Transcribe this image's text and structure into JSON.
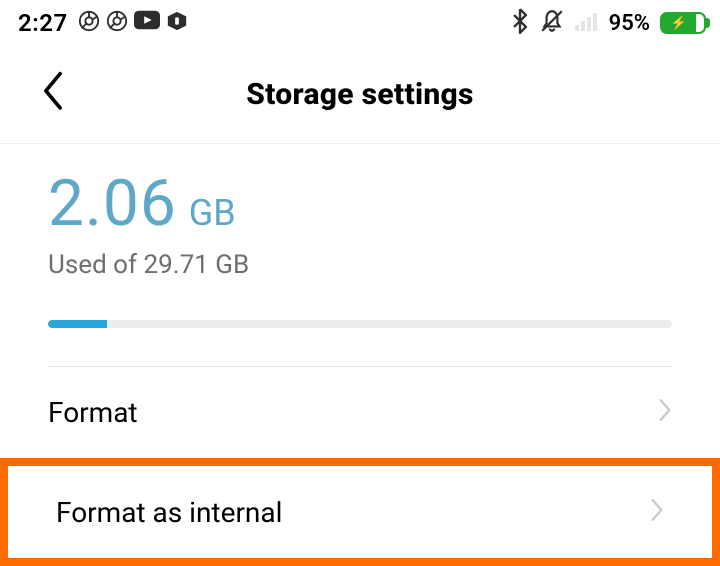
{
  "status": {
    "time": "2:27",
    "battery_percent": "95%"
  },
  "header": {
    "title": "Storage settings"
  },
  "storage": {
    "used_value": "2.06",
    "used_unit": "GB",
    "used_of_line": "Used of 29.71 GB",
    "progress_pct": 7
  },
  "rows": {
    "format": "Format",
    "format_internal": "Format as internal"
  }
}
